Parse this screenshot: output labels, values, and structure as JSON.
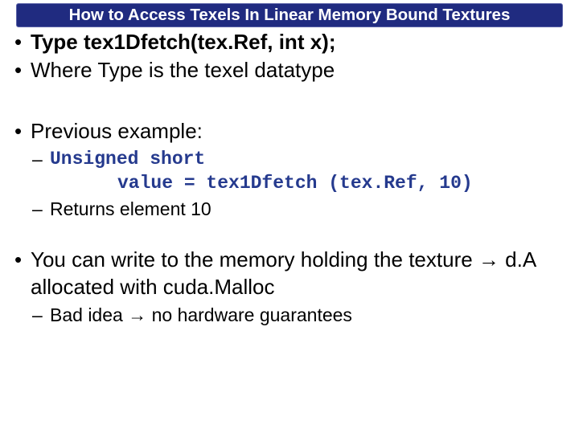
{
  "title": "How to Access Texels In Linear Memory Bound Textures",
  "b1": "Type tex1Dfetch(tex.Ref, int x);",
  "b2": "Where Type is the texel datatype",
  "b3": "Previous example:",
  "code1": "Unsigned short",
  "code2": "value = tex1Dfetch (tex.Ref, 10)",
  "sub_returns": "Returns element 10",
  "b4a": "You can write to the memory holding the texture ",
  "b4arrow": "→",
  "b4b": " d.A allocated with cuda.Malloc",
  "sub_bad_a": "Bad idea ",
  "sub_bad_arrow": "→",
  "sub_bad_b": " no hardware guarantees"
}
